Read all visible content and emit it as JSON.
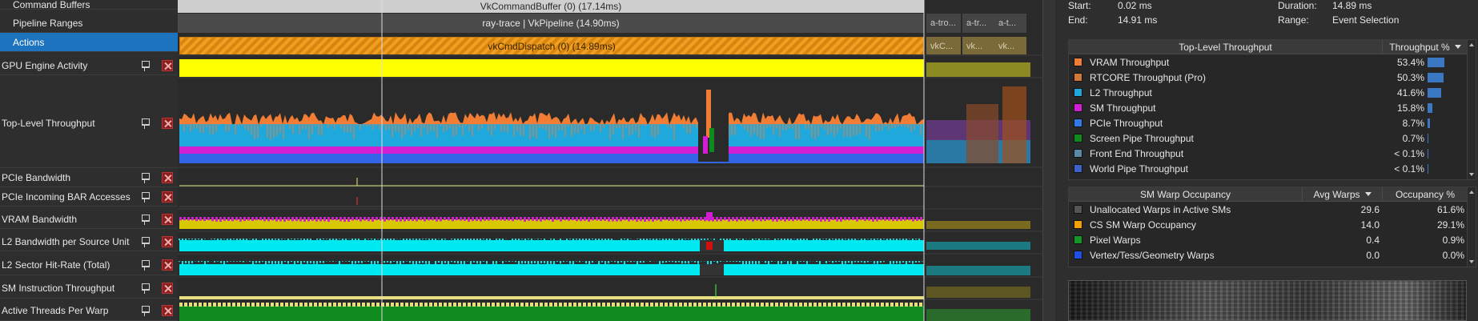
{
  "left_rows": [
    {
      "label": "Command Buffers",
      "sub": true,
      "selected": false,
      "buttons": false
    },
    {
      "label": "Pipeline Ranges",
      "sub": true,
      "selected": false,
      "buttons": false
    },
    {
      "label": "Actions",
      "sub": true,
      "selected": true,
      "buttons": false
    },
    {
      "label": "GPU Engine Activity",
      "sub": false,
      "selected": false,
      "buttons": true
    },
    {
      "label": "Top-Level Throughput",
      "sub": false,
      "selected": false,
      "buttons": true
    },
    {
      "label": "PCIe Bandwidth",
      "sub": false,
      "selected": false,
      "buttons": true
    },
    {
      "label": "PCIe Incoming BAR Accesses",
      "sub": false,
      "selected": false,
      "buttons": true
    },
    {
      "label": "VRAM Bandwidth",
      "sub": false,
      "selected": false,
      "buttons": true
    },
    {
      "label": "L2 Bandwidth per Source Unit",
      "sub": false,
      "selected": false,
      "buttons": true
    },
    {
      "label": "L2 Sector Hit-Rate (Total)",
      "sub": false,
      "selected": false,
      "buttons": true
    },
    {
      "label": "SM Instruction Throughput",
      "sub": false,
      "selected": false,
      "buttons": true
    },
    {
      "label": "Active Threads Per Warp",
      "sub": false,
      "selected": false,
      "buttons": true
    }
  ],
  "timeline": {
    "command_buffer": "VkCommandBuffer (0) (17.14ms)",
    "pipeline": "ray-trace | VkPipeline (14.90ms)",
    "dispatch": "vkCmdDispatch (0) (14.89ms)",
    "tail_pipelines": [
      "a-tro...",
      "a-tr...",
      "a-t..."
    ],
    "tail_dispatches": [
      "vkC...",
      "vk...",
      "vk..."
    ]
  },
  "range": {
    "start_label": "Start:",
    "start_value": "0.02 ms",
    "end_label": "End:",
    "end_value": "14.91 ms",
    "duration_label": "Duration:",
    "duration_value": "14.89 ms",
    "range_label": "Range:",
    "range_value": "Event Selection"
  },
  "throughput_table": {
    "headers": [
      "Top-Level Throughput",
      "Throughput %"
    ],
    "rows": [
      {
        "name": "VRAM Throughput",
        "value": "53.4%",
        "pct": 53.4,
        "color": "#f07d33"
      },
      {
        "name": "RTCORE Throughput (Pro)",
        "value": "50.3%",
        "pct": 50.3,
        "color": "#d07838"
      },
      {
        "name": "L2 Throughput",
        "value": "41.6%",
        "pct": 41.6,
        "color": "#1ea8dc"
      },
      {
        "name": "SM Throughput",
        "value": "15.8%",
        "pct": 15.8,
        "color": "#d21ed2"
      },
      {
        "name": "PCIe Throughput",
        "value": "8.7%",
        "pct": 8.7,
        "color": "#3278e6"
      },
      {
        "name": "Screen Pipe Throughput",
        "value": "0.7%",
        "pct": 0.7,
        "color": "#0f8a1e"
      },
      {
        "name": "Front End Throughput",
        "value": "< 0.1%",
        "pct": 0.1,
        "color": "#5a8aa8"
      },
      {
        "name": "World Pipe Throughput",
        "value": "< 0.1%",
        "pct": 0.1,
        "color": "#3c64c8"
      }
    ]
  },
  "warp_table": {
    "headers": [
      "SM Warp Occupancy",
      "Avg Warps",
      "Occupancy %"
    ],
    "rows": [
      {
        "name": "Unallocated Warps in Active SMs",
        "avg": "29.6",
        "occ": "61.6%",
        "color": "#555555"
      },
      {
        "name": "CS SM Warp Occupancy",
        "avg": "14.0",
        "occ": "29.1%",
        "color": "#f5a000"
      },
      {
        "name": "Pixel Warps",
        "avg": "0.4",
        "occ": "0.9%",
        "color": "#149628"
      },
      {
        "name": "Vertex/Tess/Geometry Warps",
        "avg": "0.0",
        "occ": "0.0%",
        "color": "#1e50e6"
      }
    ]
  }
}
